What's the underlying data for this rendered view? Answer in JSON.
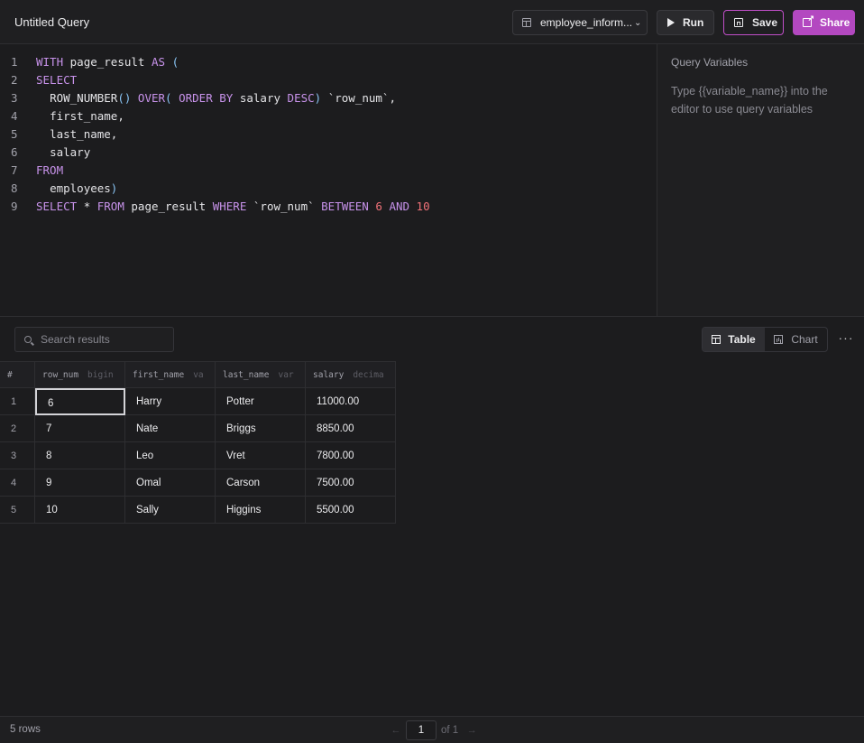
{
  "header": {
    "title": "Untitled Query",
    "database": "employee_inform...",
    "run_label": "Run",
    "save_label": "Save",
    "share_label": "Share"
  },
  "editor": {
    "lines": [
      {
        "n": "1",
        "text": "WITH page_result AS ("
      },
      {
        "n": "2",
        "text": "SELECT"
      },
      {
        "n": "3",
        "text": "  ROW_NUMBER() OVER( ORDER BY salary DESC) `row_num`,"
      },
      {
        "n": "4",
        "text": "  first_name,"
      },
      {
        "n": "5",
        "text": "  last_name,"
      },
      {
        "n": "6",
        "text": "  salary"
      },
      {
        "n": "7",
        "text": "FROM"
      },
      {
        "n": "8",
        "text": "  employees)"
      },
      {
        "n": "9",
        "text": "SELECT * FROM page_result WHERE `row_num` BETWEEN 6 AND 10"
      }
    ]
  },
  "variables": {
    "title": "Query Variables",
    "help": "Type {{variable_name}} into the editor to use query variables"
  },
  "results": {
    "search_placeholder": "Search results",
    "view_table": "Table",
    "view_chart": "Chart",
    "more": "···",
    "columns": [
      {
        "name": "#",
        "type": ""
      },
      {
        "name": "row_num",
        "type": "bigin"
      },
      {
        "name": "first_name",
        "type": "va"
      },
      {
        "name": "last_name",
        "type": "var"
      },
      {
        "name": "salary",
        "type": "decima"
      }
    ],
    "rows": [
      {
        "idx": "1",
        "row_num": "6",
        "first_name": "Harry",
        "last_name": "Potter",
        "salary": "11000.00"
      },
      {
        "idx": "2",
        "row_num": "7",
        "first_name": "Nate",
        "last_name": "Briggs",
        "salary": "8850.00"
      },
      {
        "idx": "3",
        "row_num": "8",
        "first_name": "Leo",
        "last_name": "Vret",
        "salary": "7800.00"
      },
      {
        "idx": "4",
        "row_num": "9",
        "first_name": "Omal",
        "last_name": "Carson",
        "salary": "7500.00"
      },
      {
        "idx": "5",
        "row_num": "10",
        "first_name": "Sally",
        "last_name": "Higgins",
        "salary": "5500.00"
      }
    ]
  },
  "footer": {
    "row_count": "5 rows",
    "page": "1",
    "of_pages": "of 1",
    "prev_icon": "←",
    "next_icon": "→"
  },
  "colors": {
    "accent": "#b348c0",
    "keyword": "#c792ea",
    "number": "#f07178",
    "paren": "#89c4f4"
  }
}
